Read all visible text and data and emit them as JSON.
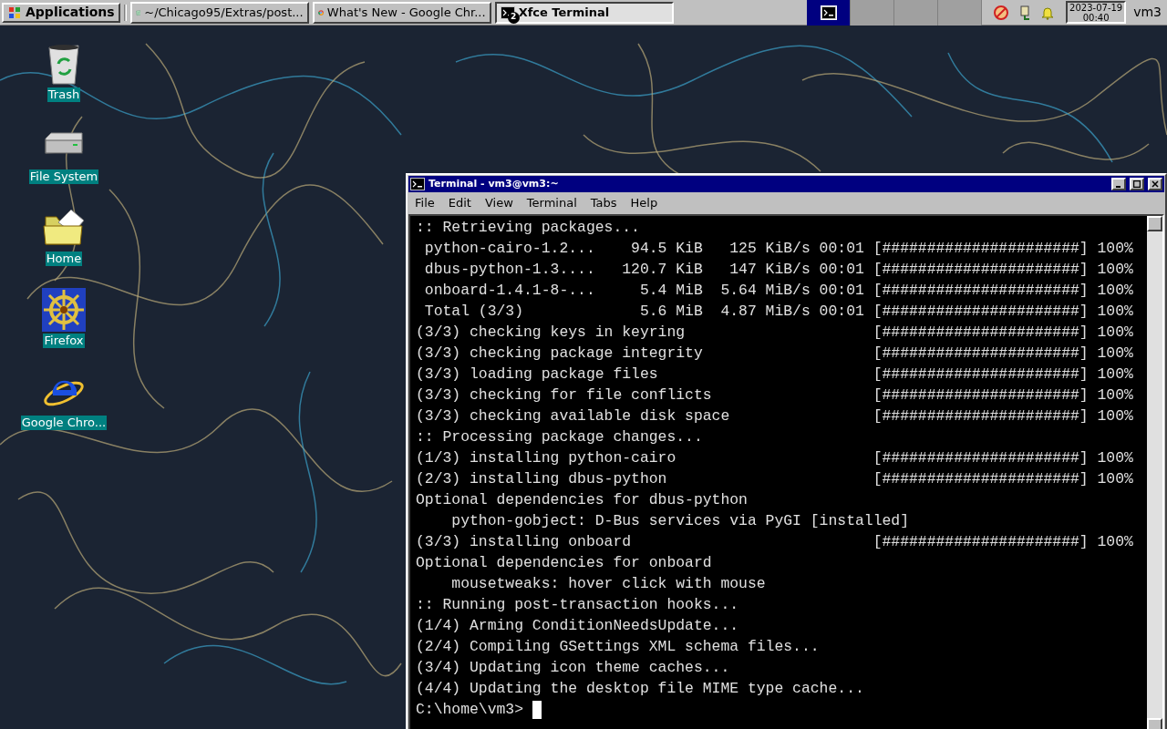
{
  "taskbar": {
    "applications_button": "Applications",
    "tasks": [
      {
        "label": "~/Chicago95/Extras/post...",
        "kind": "files",
        "selected": false
      },
      {
        "label": "What's New - Google Chr...",
        "kind": "browser",
        "selected": false
      },
      {
        "label": "Xfce Terminal",
        "kind": "terminal",
        "selected": true,
        "badge": "2"
      }
    ],
    "workspaces": [
      {
        "selected": true
      },
      {
        "selected": false
      },
      {
        "selected": false
      },
      {
        "selected": false
      }
    ],
    "clock": {
      "date": "2023-07-19",
      "time": "00:40"
    },
    "user": "vm3"
  },
  "desktop_icons": [
    {
      "label": "Trash",
      "kind": "trash"
    },
    {
      "label": "File System",
      "kind": "drive"
    },
    {
      "label": "Home",
      "kind": "folder"
    },
    {
      "label": "Firefox",
      "kind": "wheel"
    },
    {
      "label": "Google Chro...",
      "kind": "globe"
    }
  ],
  "terminal": {
    "title": "Terminal - vm3@vm3:~",
    "menu": [
      "File",
      "Edit",
      "View",
      "Terminal",
      "Tabs",
      "Help"
    ],
    "lines": [
      ":: Retrieving packages...",
      " python-cairo-1.2...    94.5 KiB   125 KiB/s 00:01 [######################] 100%",
      " dbus-python-1.3....   120.7 KiB   147 KiB/s 00:01 [######################] 100%",
      " onboard-1.4.1-8-...     5.4 MiB  5.64 MiB/s 00:01 [######################] 100%",
      " Total (3/3)             5.6 MiB  4.87 MiB/s 00:01 [######################] 100%",
      "(3/3) checking keys in keyring                     [######################] 100%",
      "(3/3) checking package integrity                   [######################] 100%",
      "(3/3) loading package files                        [######################] 100%",
      "(3/3) checking for file conflicts                  [######################] 100%",
      "(3/3) checking available disk space                [######################] 100%",
      ":: Processing package changes...",
      "(1/3) installing python-cairo                      [######################] 100%",
      "(2/3) installing dbus-python                       [######################] 100%",
      "Optional dependencies for dbus-python",
      "    python-gobject: D-Bus services via PyGI [installed]",
      "(3/3) installing onboard                           [######################] 100%",
      "Optional dependencies for onboard",
      "    mousetweaks: hover click with mouse",
      ":: Running post-transaction hooks...",
      "(1/4) Arming ConditionNeedsUpdate...",
      "(2/4) Compiling GSettings XML schema files...",
      "(3/4) Updating icon theme caches...",
      "(4/4) Updating the desktop file MIME type cache..."
    ],
    "prompt": "C:\\home\\vm3>"
  }
}
